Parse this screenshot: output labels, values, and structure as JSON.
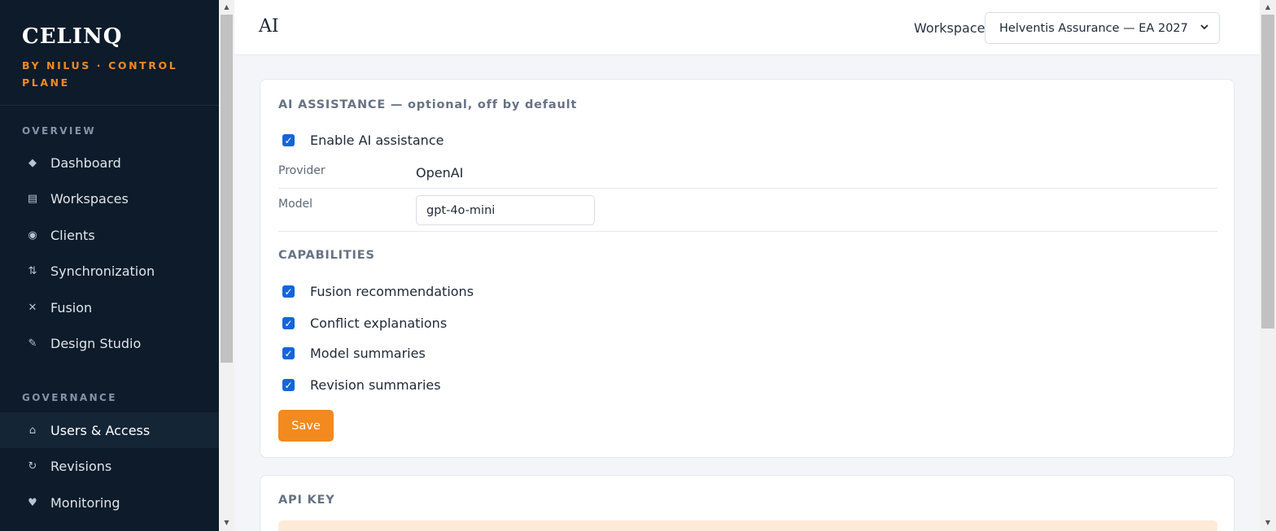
{
  "brand": {
    "name": "CELINQ",
    "subtitle": "BY NILUS · CONTROL PLANE"
  },
  "sidebar": {
    "sections": [
      {
        "label": "OVERVIEW"
      },
      {
        "label": "GOVERNANCE"
      }
    ],
    "items": [
      {
        "label": "Dashboard",
        "icon": "◆"
      },
      {
        "label": "Workspaces",
        "icon": "▤"
      },
      {
        "label": "Clients",
        "icon": "◉"
      },
      {
        "label": "Synchronization",
        "icon": "⇅"
      },
      {
        "label": "Fusion",
        "icon": "✕"
      },
      {
        "label": "Design Studio",
        "icon": "✎"
      },
      {
        "label": "Users & Access",
        "icon": "⌂"
      },
      {
        "label": "Revisions",
        "icon": "↻"
      },
      {
        "label": "Monitoring",
        "icon": "♥"
      }
    ]
  },
  "header": {
    "title": "AI",
    "workspace_label": "Workspace",
    "workspace_value": "Helventis Assurance — EA 2027"
  },
  "ai_card": {
    "title": "AI ASSISTANCE — optional, off by default",
    "enable_label": "Enable AI assistance",
    "provider_label": "Provider",
    "provider_value": "OpenAI",
    "model_label": "Model",
    "model_value": "gpt-4o-mini",
    "capabilities_title": "CAPABILITIES",
    "capabilities": [
      {
        "label": "Fusion recommendations"
      },
      {
        "label": "Conflict explanations"
      },
      {
        "label": "Model summaries"
      },
      {
        "label": "Revision summaries"
      }
    ],
    "save_label": "Save"
  },
  "api_card": {
    "title": "API KEY"
  }
}
